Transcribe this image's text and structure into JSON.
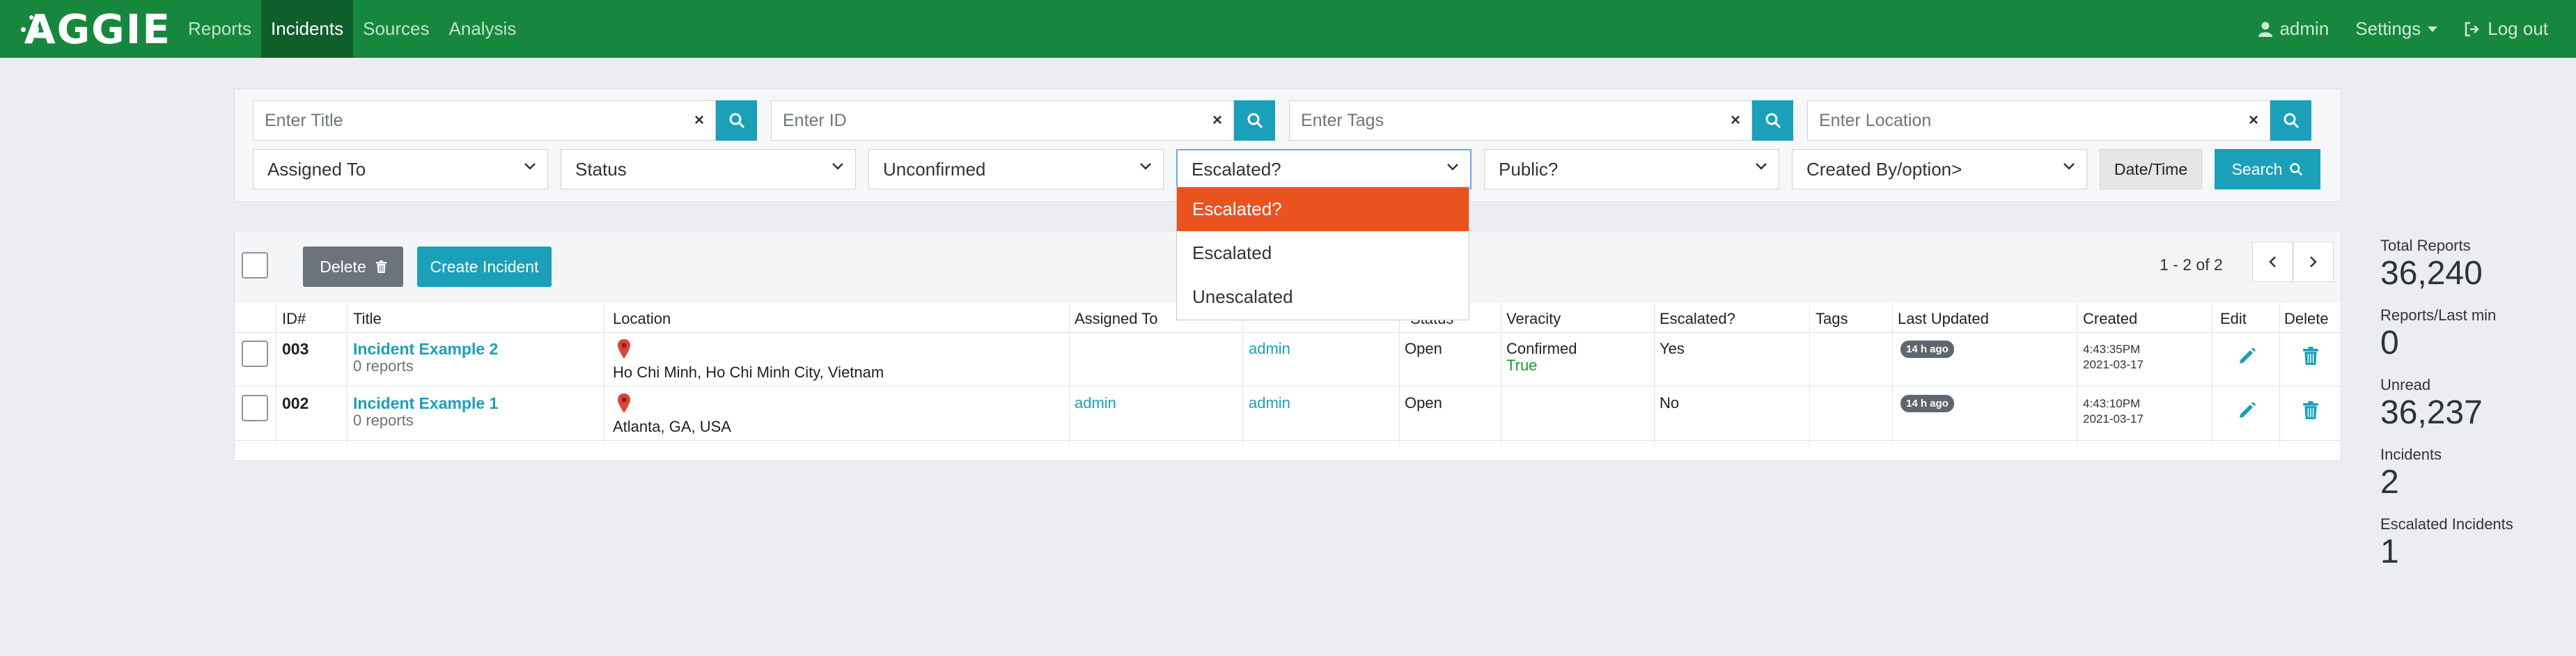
{
  "nav": {
    "logo": "AGGIE",
    "links": [
      "Reports",
      "Incidents",
      "Sources",
      "Analysis"
    ],
    "active": "Incidents",
    "user": "admin",
    "settings": "Settings",
    "logout": "Log out"
  },
  "filters": {
    "title_placeholder": "Enter Title",
    "id_placeholder": "Enter ID",
    "tags_placeholder": "Enter Tags",
    "location_placeholder": "Enter Location",
    "clear_glyph": "×",
    "selects": [
      "Assigned To",
      "Status",
      "Unconfirmed",
      "Escalated?",
      "Public?",
      "Created By/option>"
    ],
    "date_button": "Date/Time",
    "search_button": "Search"
  },
  "dropdown": {
    "options": [
      "Escalated?",
      "Escalated",
      "Unescalated"
    ],
    "selected": "Escalated?"
  },
  "toolbar": {
    "delete": "Delete",
    "create": "Create Incident",
    "pager": "1 - 2 of 2"
  },
  "columns": [
    "ID#",
    "Title",
    "Location",
    "Assigned To",
    "Status",
    "Veracity",
    "Escalated?",
    "Tags",
    "Last Updated",
    "Created",
    "Edit",
    "Delete"
  ],
  "rows": [
    {
      "id": "003",
      "title": "Incident Example 2",
      "reports": "0 reports",
      "location": "Ho Chi Minh, Ho Chi Minh City, Vietnam",
      "assigned_to": "",
      "creator": "admin",
      "status": "Open",
      "veracity": "Confirmed",
      "veracity_value": "True",
      "escalated": "Yes",
      "tags": "",
      "last_updated": "14 h ago",
      "created_time": "4:43:35PM",
      "created_date": "2021-03-17"
    },
    {
      "id": "002",
      "title": "Incident Example 1",
      "reports": "0 reports",
      "location": "Atlanta, GA, USA",
      "assigned_to": "admin",
      "creator": "admin",
      "status": "Open",
      "veracity": "",
      "veracity_value": "",
      "escalated": "No",
      "tags": "",
      "last_updated": "14 h ago",
      "created_time": "4:43:10PM",
      "created_date": "2021-03-17"
    }
  ],
  "stats": [
    {
      "label": "Total Reports",
      "value": "36,240"
    },
    {
      "label": "Reports/Last min",
      "value": "0"
    },
    {
      "label": "Unread",
      "value": "36,237"
    },
    {
      "label": "Incidents",
      "value": "2"
    },
    {
      "label": "Escalated Incidents",
      "value": "1"
    }
  ],
  "colors": {
    "navbar": "#18873e",
    "accent": "#1aa0b8",
    "dropdown_highlight": "#ea5320"
  }
}
